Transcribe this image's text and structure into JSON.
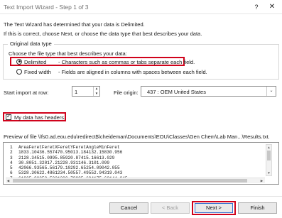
{
  "window": {
    "title": "Text Import Wizard - Step 1 of 3",
    "help_label": "?",
    "close_label": "✕"
  },
  "intro": {
    "line1": "The Text Wizard has determined that your data is Delimited.",
    "line2": "If this is correct, choose Next, or choose the data type that best describes your data."
  },
  "original_data_type": {
    "group_label": "Original data type",
    "prompt": "Choose the file type that best describes your data:",
    "options": [
      {
        "name": "Delimited",
        "description": "- Characters such as commas or tabs separate each field.",
        "selected": true
      },
      {
        "name": "Fixed width",
        "description": "- Fields are aligned in columns with spaces between each field.",
        "selected": false
      }
    ]
  },
  "start_import": {
    "label": "Start import at row:",
    "value": "1",
    "up_glyph": "▲",
    "down_glyph": "▼"
  },
  "file_origin": {
    "label": "File origin:",
    "value": "437 : OEM United States",
    "chevron": "⌄"
  },
  "headers": {
    "label": "My data has headers.",
    "checked": true,
    "check_glyph": "✓"
  },
  "preview": {
    "label": "Preview of file \\\\fs0.ad.eou.edu\\redirect$\\cheideman\\Documents\\EOU\\Classes\\Gen Chem\\Lab Man...\\Results.txt.",
    "rows": [
      {
        "num": "1",
        "text": "AreaFeretFeretXFeretYFeretAngleMinFeret"
      },
      {
        "num": "2",
        "text": "1833.10436.557470.95013.184132.15830.956"
      },
      {
        "num": "3",
        "text": "2128.34515.0995.85920.87415.16613.029"
      },
      {
        "num": "4",
        "text": "30.8051.32017.21228.931146.3101.099"
      },
      {
        "num": "5",
        "text": "42066.93565.56179.10292.65254.09042.055"
      },
      {
        "num": "6",
        "text": "5328.30622.4861234.50557.49552.94319.043"
      },
      {
        "num": "7",
        "text": "61825.80252.5231300.78985.694175.60144.945"
      }
    ],
    "scroll_up": "▲",
    "scroll_down": "▼",
    "scroll_left": "◀",
    "scroll_right": "▶"
  },
  "buttons": {
    "cancel": "Cancel",
    "back": "< Back",
    "next": "Next >",
    "finish": "Finish"
  },
  "highlight_color": "#d0021b"
}
